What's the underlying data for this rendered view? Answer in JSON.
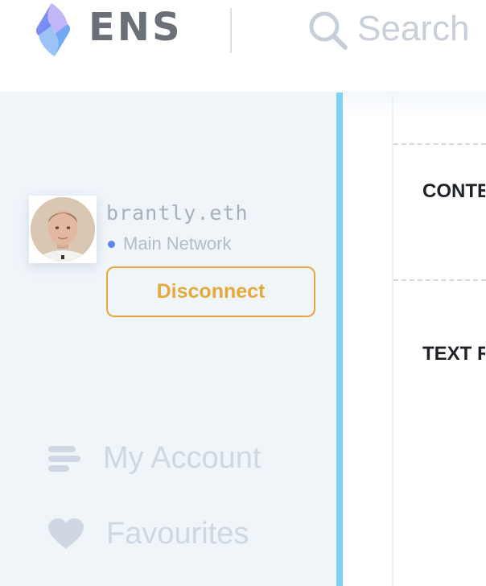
{
  "header": {
    "logo_text": "ENS",
    "search": {
      "placeholder": "Search"
    }
  },
  "sidebar": {
    "account": {
      "name": "brantly.eth",
      "network": "Main Network",
      "disconnect_label": "Disconnect"
    },
    "nav": [
      {
        "label": "My Account",
        "icon": "account-icon"
      },
      {
        "label": "Favourites",
        "icon": "heart-icon"
      }
    ]
  },
  "main": {
    "records": [
      {
        "label": "CONTENT"
      },
      {
        "label": "TEXT RECORD"
      }
    ]
  },
  "colors": {
    "accent_orange": "#e5a93c",
    "sidebar_bg": "#f0f5fa",
    "sidebar_edge": "#7fd3f2",
    "network_dot": "#5c87e8"
  }
}
